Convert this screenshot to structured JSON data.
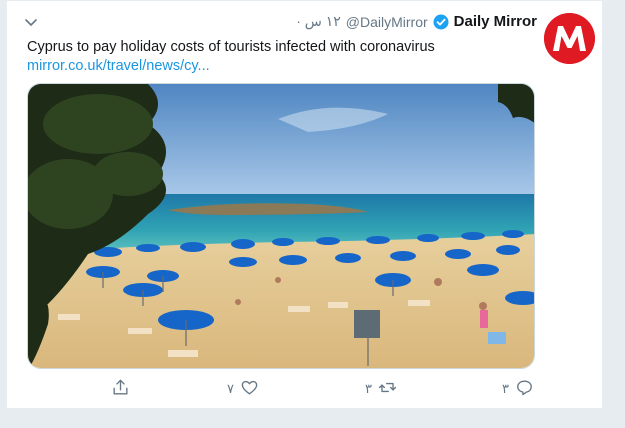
{
  "tweet": {
    "display_name": "Daily Mirror",
    "handle": "@DailyMirror",
    "time": "١٢ س ·",
    "text": "Cyprus to pay holiday costs of tourists infected with coronavirus",
    "link": "mirror.co.uk/travel/news/cy..."
  },
  "avatar": {
    "letter": "M"
  },
  "actions": {
    "reply_count": "٣",
    "retweet_count": "٣",
    "like_count": "٧"
  },
  "colors": {
    "brand_red": "#e01a22",
    "link_blue": "#1b95e0",
    "verified_blue": "#1da1f2",
    "muted_text": "#657786"
  },
  "icons": [
    "chevron-down-icon",
    "verified-badge-icon",
    "reply-icon",
    "retweet-icon",
    "like-icon",
    "share-icon"
  ]
}
